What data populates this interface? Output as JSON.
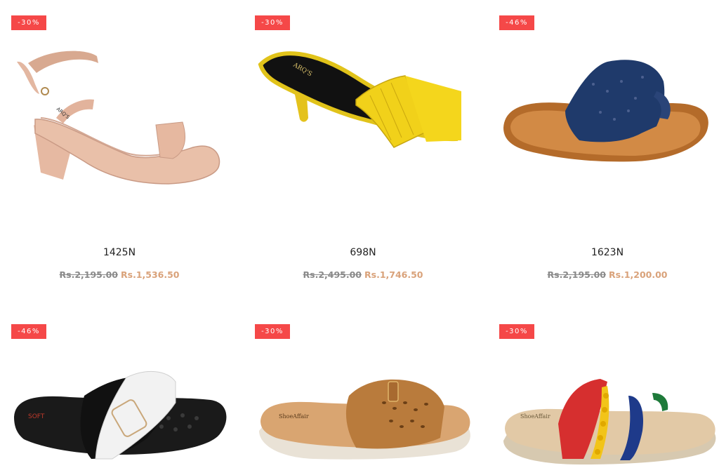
{
  "products": [
    {
      "badge": "-30%",
      "name": "1425N",
      "old_price": "Rs.2,195.00",
      "new_price": "Rs.1,536.50",
      "image_icon": "rose-gold-heeled-sandal"
    },
    {
      "badge": "-30%",
      "name": "698N",
      "old_price": "Rs.2,495.00",
      "new_price": "Rs.1,746.50",
      "image_icon": "yellow-woven-heeled-mule"
    },
    {
      "badge": "-46%",
      "name": "1623N",
      "old_price": "Rs.2,195.00",
      "new_price": "Rs.1,200.00",
      "image_icon": "navy-toe-ring-flat-sandal"
    },
    {
      "badge": "-46%",
      "image_icon": "black-white-cross-strap-slide"
    },
    {
      "badge": "-30%",
      "image_icon": "tan-laser-cut-wedge-slide"
    },
    {
      "badge": "-30%",
      "image_icon": "multicolor-strap-toe-ring-sandal"
    }
  ],
  "colors": {
    "badge": "#f54848",
    "sale_price": "#d9a27a",
    "old_price": "#8a8a8a"
  }
}
